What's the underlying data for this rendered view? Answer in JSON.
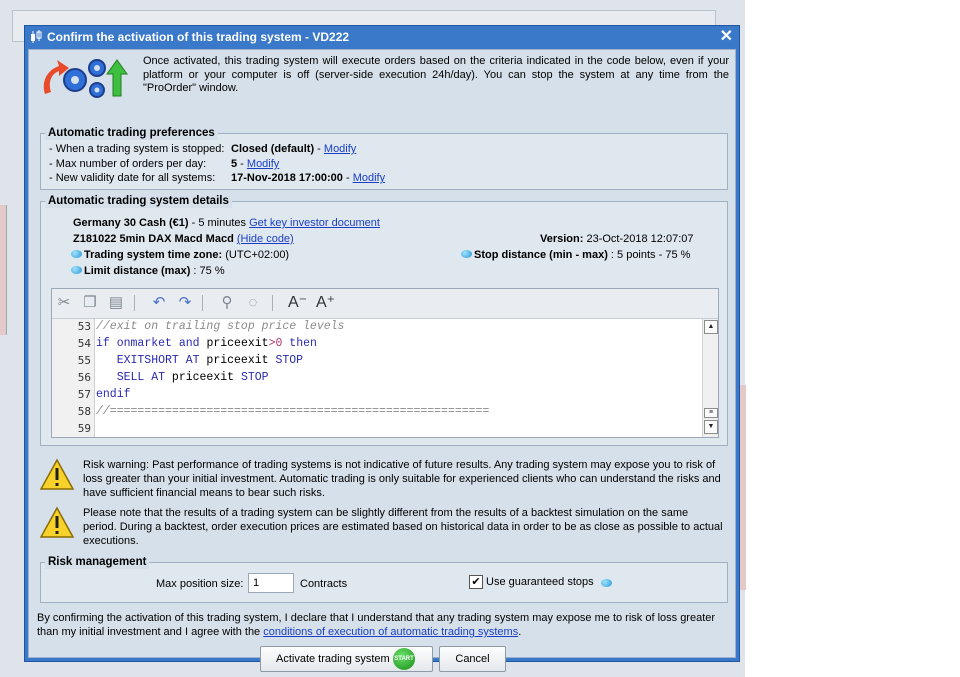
{
  "dialog": {
    "title": "Confirm the activation of this trading system  - VD222",
    "close_label": "✕",
    "intro": "Once activated, this trading system will execute orders based on the criteria indicated in the code below, even if your platform or your computer is off (server-side execution 24h/day). You can stop the system at any time from the \"ProOrder\" window."
  },
  "preferences": {
    "title": "Automatic trading preferences",
    "rows": [
      {
        "label": "- When a trading system is stopped:",
        "value": "Closed (default)",
        "sep": " - ",
        "link": "Modify"
      },
      {
        "label": "- Max number of orders per day:",
        "value": "5",
        "sep": " - ",
        "link": "Modify"
      },
      {
        "label": "- New validity date for all systems:",
        "value": "17-Nov-2018 17:00:00",
        "sep": " - ",
        "link": "Modify"
      }
    ]
  },
  "details": {
    "title": "Automatic trading system details",
    "instrument": "Germany 30 Cash (€1)",
    "timeframe": " - 5 minutes ",
    "kid_link": "Get key investor document",
    "system_name": "Z181022 5min DAX Macd Macd",
    "hide_code": "(Hide code)",
    "version_label": "Version:",
    "version_value": " 23-Oct-2018 12:07:07",
    "timezone_label": "Trading system time zone:",
    "timezone_value": " (UTC+02:00)",
    "stop_label": "Stop distance (min - max)",
    "stop_value": " : 5 points - 75 %",
    "limit_label": "Limit distance (max)",
    "limit_value": " : 75 %"
  },
  "code": {
    "lines": [
      {
        "n": "53",
        "parts": [
          {
            "t": "//exit on trailing stop price levels",
            "c": "c-com"
          }
        ]
      },
      {
        "n": "54",
        "parts": [
          {
            "t": "if ",
            "c": "c-kw"
          },
          {
            "t": "onmarket ",
            "c": "c-kw"
          },
          {
            "t": "and ",
            "c": "c-kw"
          },
          {
            "t": "priceexit",
            "c": ""
          },
          {
            "t": ">",
            "c": "c-op"
          },
          {
            "t": "0 ",
            "c": "c-op"
          },
          {
            "t": "then",
            "c": "c-kw"
          }
        ]
      },
      {
        "n": "55",
        "parts": [
          {
            "t": "   EXITSHORT AT ",
            "c": "c-kw"
          },
          {
            "t": "priceexit ",
            "c": ""
          },
          {
            "t": "STOP",
            "c": "c-kw"
          }
        ]
      },
      {
        "n": "56",
        "parts": [
          {
            "t": "   SELL AT ",
            "c": "c-kw"
          },
          {
            "t": "priceexit ",
            "c": ""
          },
          {
            "t": "STOP",
            "c": "c-kw"
          }
        ]
      },
      {
        "n": "57",
        "parts": [
          {
            "t": "endif",
            "c": "c-kw"
          }
        ]
      },
      {
        "n": "58",
        "parts": [
          {
            "t": "//=======================================================",
            "c": "c-com"
          }
        ]
      },
      {
        "n": "59",
        "parts": [
          {
            "t": "",
            "c": ""
          }
        ]
      }
    ]
  },
  "warnings": {
    "risk": "Risk warning: Past performance of trading systems is not indicative of future results. Any trading system may expose you to risk of loss greater than your initial investment. Automatic trading is only suitable for experienced clients who can understand the risks and have sufficient financial means to bear such risks.",
    "backtest": "Please note that the results of a trading system can be slightly different from the results of a backtest simulation on the same period. During a backtest, order execution prices are estimated based on historical data in order to be as close as possible to actual executions."
  },
  "risk": {
    "title": "Risk management",
    "max_pos_label": "Max position size:",
    "max_pos_value": "1",
    "contracts": "Contracts",
    "guaranteed_label": "Use guaranteed stops",
    "guaranteed_checked": "✔"
  },
  "footer": {
    "declaration": "By confirming the activation of this trading system, I declare that I understand that any trading system may expose me to risk of loss greater than my initial investment and I agree with the ",
    "conditions_link": "conditions of execution of automatic trading systems",
    "period": ".",
    "activate_label": "Activate trading system",
    "start_badge": "START",
    "cancel_label": "Cancel"
  },
  "colors": {
    "dialog_frame": "#3a78c9",
    "link": "#1a3fc4",
    "start_green": "#168d16"
  }
}
